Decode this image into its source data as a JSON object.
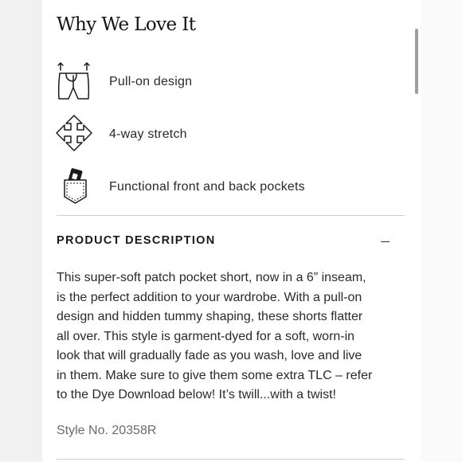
{
  "section": {
    "title": "Why We Love It"
  },
  "features": [
    {
      "label": "Pull-on design",
      "icon": "pull-on-pants-icon"
    },
    {
      "label": "4-way stretch",
      "icon": "four-way-arrows-icon"
    },
    {
      "label": "Functional front and back pockets",
      "icon": "pocket-icon"
    }
  ],
  "product_description": {
    "heading": "PRODUCT DESCRIPTION",
    "toggle_icon": "minus-icon",
    "lines": [
      "This super-soft patch pocket short, now in a 6” inseam,",
      "is the perfect addition to your wardrobe. With a pull-on",
      "design and hidden tummy shaping, these shorts flatter",
      "all over. This style is garment-dyed for a soft, worn-in",
      "look that will gradually fade as you wash, love and live",
      "in them. Make sure to give them some extra TLC – refer",
      "to the Dye Download below! It’s twill...with a twist!"
    ],
    "style_number": "Style No. 20358R"
  }
}
